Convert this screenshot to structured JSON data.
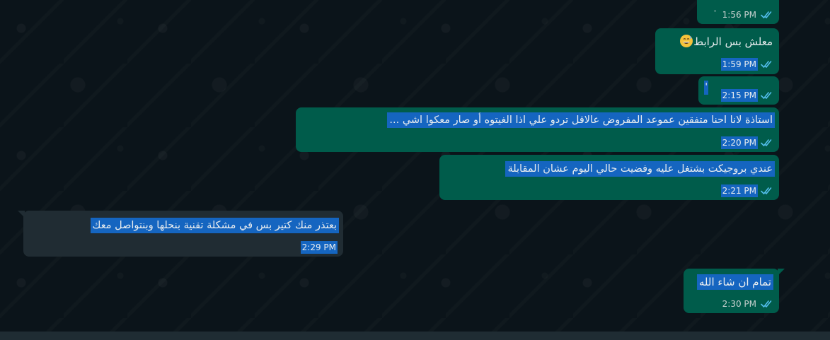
{
  "messages": [
    {
      "text": "'",
      "time": "1:56 PM"
    },
    {
      "text": "معلش بس الرابط",
      "time": "1:59 PM",
      "emoji": "grinning-sweat-emoji"
    },
    {
      "text": "'",
      "time": "2:15 PM"
    },
    {
      "text": "استاذة لانا احنا متفقين عموعد المفروض عالاقل تردو علي اذا الغيتوه أو صار معكوا اشي ...",
      "time": "2:20 PM"
    },
    {
      "text": "عندي بروجيكت بشتغل عليه وفضيت حالي اليوم عشان المقابلة",
      "time": "2:21 PM"
    },
    {
      "text": "بعتذر منك كتير بس في مشكلة تقنية بنحلها وبنتواصل معك",
      "time": "2:29 PM"
    },
    {
      "text": "تمام ان شاء الله",
      "time": "2:30 PM"
    }
  ],
  "colors": {
    "background": "#0b141a",
    "outgoing_bubble": "#005c4b",
    "incoming_bubble": "#202c33",
    "selection": "#1565c0",
    "read_tick": "#53bdeb"
  }
}
